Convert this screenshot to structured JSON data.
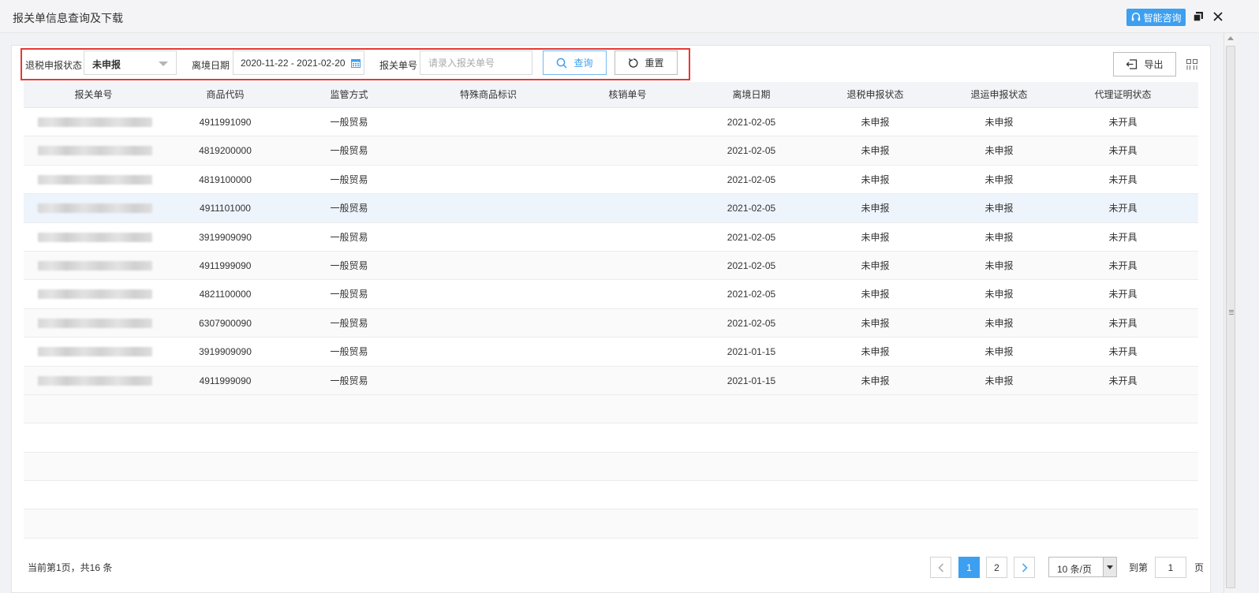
{
  "window": {
    "title": "报关单信息查询及下载",
    "consult_label": "智能咨询"
  },
  "filters": {
    "tax_status_label": "退税申报状态",
    "tax_status_value": "未申报",
    "date_label": "离境日期",
    "date_value": "2020-11-22 - 2021-02-20",
    "decl_no_label": "报关单号",
    "decl_no_placeholder": "请录入报关单号",
    "query_label": "查询",
    "reset_label": "重置",
    "export_label": "导出"
  },
  "table": {
    "columns": [
      "报关单号",
      "商品代码",
      "监管方式",
      "特殊商品标识",
      "核销单号",
      "离境日期",
      "退税申报状态",
      "退运申报状态",
      "代理证明状态"
    ],
    "rows": [
      {
        "code": "4911991090",
        "mode": "一般贸易",
        "special": "",
        "verify": "",
        "date": "2021-02-05",
        "tax": "未申报",
        "ret": "未申报",
        "agent": "未开具"
      },
      {
        "code": "4819200000",
        "mode": "一般贸易",
        "special": "",
        "verify": "",
        "date": "2021-02-05",
        "tax": "未申报",
        "ret": "未申报",
        "agent": "未开具"
      },
      {
        "code": "4819100000",
        "mode": "一般贸易",
        "special": "",
        "verify": "",
        "date": "2021-02-05",
        "tax": "未申报",
        "ret": "未申报",
        "agent": "未开具"
      },
      {
        "code": "4911101000",
        "mode": "一般贸易",
        "special": "",
        "verify": "",
        "date": "2021-02-05",
        "tax": "未申报",
        "ret": "未申报",
        "agent": "未开具"
      },
      {
        "code": "3919909090",
        "mode": "一般贸易",
        "special": "",
        "verify": "",
        "date": "2021-02-05",
        "tax": "未申报",
        "ret": "未申报",
        "agent": "未开具"
      },
      {
        "code": "4911999090",
        "mode": "一般贸易",
        "special": "",
        "verify": "",
        "date": "2021-02-05",
        "tax": "未申报",
        "ret": "未申报",
        "agent": "未开具"
      },
      {
        "code": "4821100000",
        "mode": "一般贸易",
        "special": "",
        "verify": "",
        "date": "2021-02-05",
        "tax": "未申报",
        "ret": "未申报",
        "agent": "未开具"
      },
      {
        "code": "6307900090",
        "mode": "一般贸易",
        "special": "",
        "verify": "",
        "date": "2021-02-05",
        "tax": "未申报",
        "ret": "未申报",
        "agent": "未开具"
      },
      {
        "code": "3919909090",
        "mode": "一般贸易",
        "special": "",
        "verify": "",
        "date": "2021-01-15",
        "tax": "未申报",
        "ret": "未申报",
        "agent": "未开具"
      },
      {
        "code": "4911999090",
        "mode": "一般贸易",
        "special": "",
        "verify": "",
        "date": "2021-01-15",
        "tax": "未申报",
        "ret": "未申报",
        "agent": "未开具"
      }
    ]
  },
  "pagination": {
    "summary": "当前第1页，共16 条",
    "pages": [
      "1",
      "2"
    ],
    "page_size": "10 条/页",
    "goto_label": "到第",
    "goto_value": "1",
    "page_suffix": "页"
  },
  "colors": {
    "accent": "#3d9ff0",
    "highlight_border": "#e53935"
  }
}
